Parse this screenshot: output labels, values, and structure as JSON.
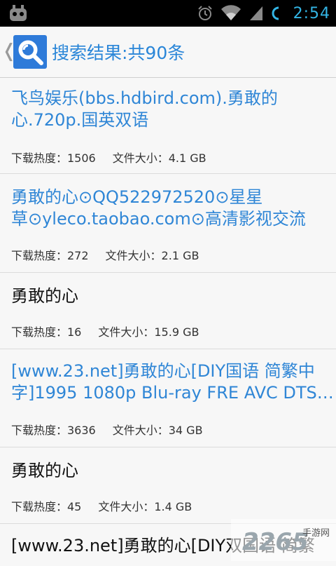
{
  "status_bar": {
    "time": "2:54"
  },
  "header": {
    "title": "搜索结果:共90条",
    "back_glyph": "❬"
  },
  "results": [
    {
      "name": "飞鸟娱乐(bbs.hdbird.com).勇敢的心.720p.国英双语",
      "line1": "飞鸟娱乐(bbs.hdbird.com).勇敢的",
      "line2": "心.720p.国英双语",
      "heat_label": "下载热度：1506",
      "size_label": "文件大小：4.1 GB"
    },
    {
      "name": "勇敢的心⊙QQ522972520⊙星星草⊙yleco.taobao.com⊙高清影视交流",
      "line1": "勇敢的心⊙QQ522972520⊙星星",
      "line2": "草⊙yleco.taobao.com⊙高清影视交流",
      "heat_label": "下载热度：272",
      "size_label": "文件大小：2.1 GB"
    },
    {
      "name": "勇敢的心",
      "line1": "勇敢的心",
      "line2": "",
      "heat_label": "下载热度：16",
      "size_label": "文件大小：15.9 GB"
    },
    {
      "name": "[www.23.net]勇敢的心[DIY国语 简繁中字]1995 1080p Blu-ray FRE AVC DTS…",
      "line1": "[www.23.net]勇敢的心[DIY国语 简繁中",
      "line2": "字]1995 1080p Blu-ray FRE AVC DTS…",
      "heat_label": "下载热度：3636",
      "size_label": "文件大小：34 GB"
    },
    {
      "name": "勇敢的心",
      "line1": "勇敢的心",
      "line2": "",
      "heat_label": "下载热度：45",
      "size_label": "文件大小：1.4 GB"
    },
    {
      "name": "[www.23.net]勇敢的心[DIY双国语 简繁",
      "line1": "[www.23.net]勇敢的心[DIY双国语 简繁",
      "line2": "",
      "heat_label": "",
      "size_label": ""
    }
  ],
  "watermark": {
    "brand_digits": "2265",
    "brand_text": "手游网"
  },
  "colors": {
    "status_time": "#33b5e5",
    "link": "#2f86d6",
    "title": "#2a86d8",
    "icon_bg": "#2f7bd9"
  }
}
